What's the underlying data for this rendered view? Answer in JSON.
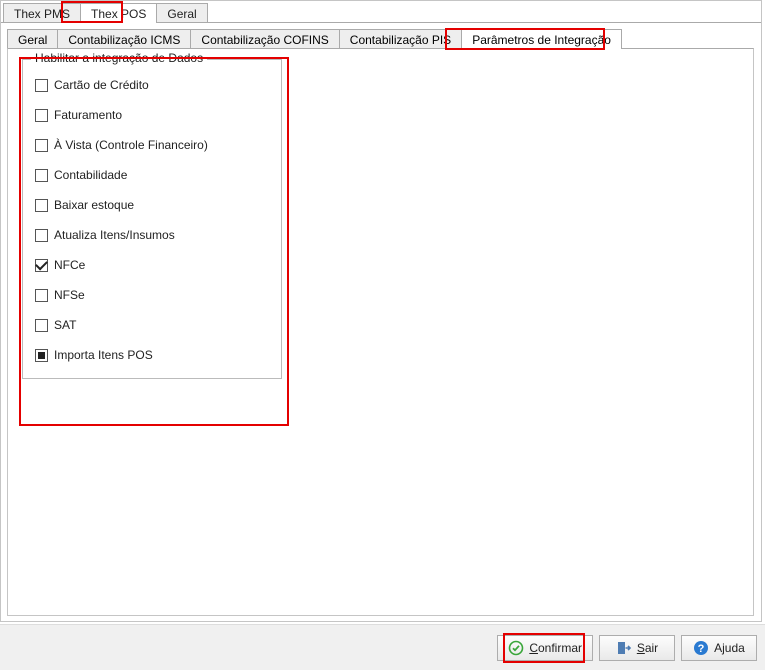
{
  "outer_tabs": [
    {
      "label": "Thex PMS"
    },
    {
      "label": "Thex POS"
    },
    {
      "label": "Geral"
    }
  ],
  "inner_tabs": [
    {
      "label": "Geral"
    },
    {
      "label": "Contabilização ICMS"
    },
    {
      "label": "Contabilização COFINS"
    },
    {
      "label": "Contabilização PIS"
    },
    {
      "label": "Parâmetros de Integração"
    }
  ],
  "fieldset_title": "Habilitar a integração de Dados",
  "checks": [
    {
      "label": "Cartão de Crédito",
      "state": "unchecked"
    },
    {
      "label": "Faturamento",
      "state": "unchecked"
    },
    {
      "label": "À Vista (Controle Financeiro)",
      "state": "unchecked"
    },
    {
      "label": "Contabilidade",
      "state": "unchecked"
    },
    {
      "label": "Baixar estoque",
      "state": "unchecked"
    },
    {
      "label": "Atualiza Itens/Insumos",
      "state": "unchecked"
    },
    {
      "label": "NFCe",
      "state": "checked"
    },
    {
      "label": "NFSe",
      "state": "unchecked"
    },
    {
      "label": "SAT",
      "state": "unchecked"
    },
    {
      "label": "Importa Itens POS",
      "state": "mixed"
    }
  ],
  "buttons": {
    "confirm": "Confirmar",
    "exit": "Sair",
    "help": "Ajuda"
  }
}
